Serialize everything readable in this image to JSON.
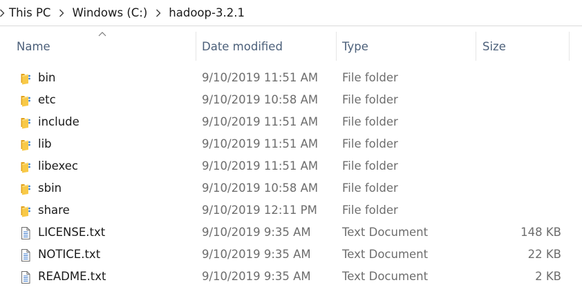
{
  "breadcrumb": {
    "items": [
      "This PC",
      "Windows (C:)",
      "hadoop-3.2.1"
    ]
  },
  "columns": {
    "name": "Name",
    "date_modified": "Date modified",
    "type": "Type",
    "size": "Size",
    "sorted_by": "Name",
    "sort_direction": "ascending"
  },
  "colors": {
    "folder": "#f8c948",
    "header_text": "#4c607a",
    "secondary_text": "#6d6d6d"
  },
  "files": [
    {
      "icon": "folder-icon",
      "name": "bin",
      "date": "9/10/2019 11:51 AM",
      "type": "File folder",
      "size": ""
    },
    {
      "icon": "folder-icon",
      "name": "etc",
      "date": "9/10/2019 10:58 AM",
      "type": "File folder",
      "size": ""
    },
    {
      "icon": "folder-icon",
      "name": "include",
      "date": "9/10/2019 11:51 AM",
      "type": "File folder",
      "size": ""
    },
    {
      "icon": "folder-icon",
      "name": "lib",
      "date": "9/10/2019 11:51 AM",
      "type": "File folder",
      "size": ""
    },
    {
      "icon": "folder-icon",
      "name": "libexec",
      "date": "9/10/2019 11:51 AM",
      "type": "File folder",
      "size": ""
    },
    {
      "icon": "folder-icon",
      "name": "sbin",
      "date": "9/10/2019 10:58 AM",
      "type": "File folder",
      "size": ""
    },
    {
      "icon": "folder-icon",
      "name": "share",
      "date": "9/10/2019 12:11 PM",
      "type": "File folder",
      "size": ""
    },
    {
      "icon": "text-document-icon",
      "name": "LICENSE.txt",
      "date": "9/10/2019 9:35 AM",
      "type": "Text Document",
      "size": "148 KB"
    },
    {
      "icon": "text-document-icon",
      "name": "NOTICE.txt",
      "date": "9/10/2019 9:35 AM",
      "type": "Text Document",
      "size": "22 KB"
    },
    {
      "icon": "text-document-icon",
      "name": "README.txt",
      "date": "9/10/2019 9:35 AM",
      "type": "Text Document",
      "size": "2 KB"
    }
  ]
}
